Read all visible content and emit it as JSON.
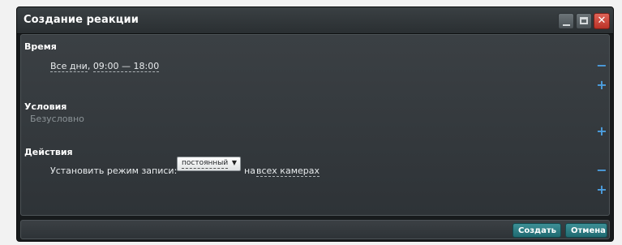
{
  "window": {
    "title": "Создание реакции"
  },
  "time": {
    "heading": "Время",
    "schedule_days": "Все дни",
    "schedule_sep": ",",
    "schedule_range": "09:00 — 18:00",
    "remove_label": "−",
    "add_label": "+"
  },
  "conditions": {
    "heading": "Условия",
    "value": "Безусловно",
    "add_label": "+"
  },
  "actions": {
    "heading": "Действия",
    "label": "Установить режим записи:",
    "mode_value": "постоянный",
    "mode_arrow": "▼",
    "on_label": "на",
    "cameras": "всех камерах",
    "remove_label": "−",
    "add_label": "+"
  },
  "footer": {
    "create_label": "Создать",
    "cancel_label": "Отмена"
  },
  "colors": {
    "accent": "#4c9fe0",
    "button": "#2b7c83",
    "close": "#d24a3e"
  }
}
